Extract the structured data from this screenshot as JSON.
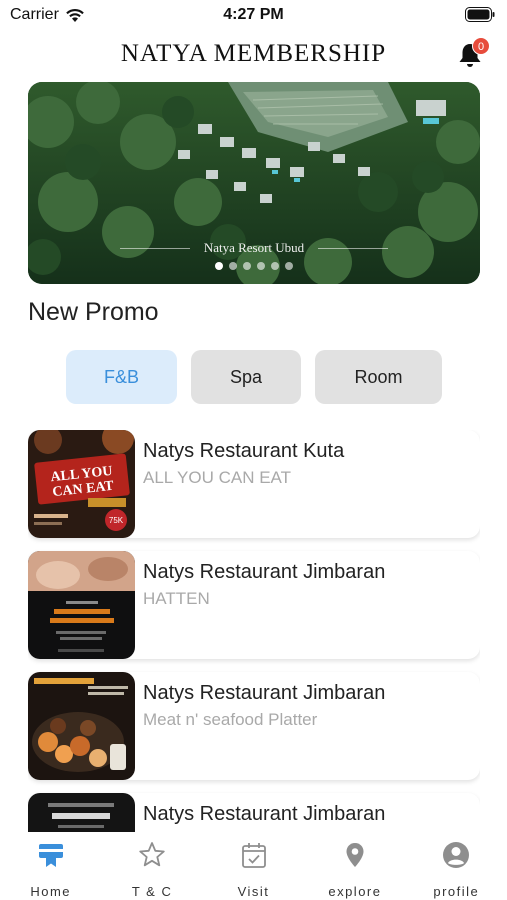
{
  "status": {
    "carrier": "Carrier",
    "time": "4:27 PM"
  },
  "header": {
    "title": "NATYA MEMBERSHIP",
    "notification_count": "0"
  },
  "banner": {
    "caption": "Natya Resort Ubud",
    "dot_count": 6,
    "active_dot": 0
  },
  "section": {
    "title": "New Promo"
  },
  "tabs": [
    {
      "label": "F&B",
      "active": true
    },
    {
      "label": "Spa",
      "active": false
    },
    {
      "label": "Room",
      "active": false
    }
  ],
  "promos": [
    {
      "name": "Natys Restaurant Kuta",
      "desc": "ALL YOU CAN EAT",
      "thumb_text": "ALL YOU CAN EAT"
    },
    {
      "name": "Natys Restaurant Jimbaran",
      "desc": "HATTEN",
      "thumb_text": "Wine By Glass Buy 1 Get 1 Free"
    },
    {
      "name": "Natys Restaurant Jimbaran",
      "desc": "Meat n' seafood Platter",
      "thumb_text": "Meat n' Seafood Platter"
    },
    {
      "name": "Natys Restaurant Jimbaran",
      "desc": "",
      "thumb_text": "IDR 150K"
    }
  ],
  "nav": [
    {
      "label": "Home",
      "icon": "home-card-icon",
      "active": true
    },
    {
      "label": "T & C",
      "icon": "star-icon",
      "active": false
    },
    {
      "label": "Visit",
      "icon": "calendar-check-icon",
      "active": false
    },
    {
      "label": "explore",
      "icon": "location-pin-icon",
      "active": false
    },
    {
      "label": "profile",
      "icon": "user-circle-icon",
      "active": false
    }
  ],
  "colors": {
    "accent": "#3a8fdb",
    "tab_active_bg": "#dcecfb",
    "tab_bg": "#e1e1e1",
    "badge": "#e74c3c",
    "muted_text": "#a9a9a9"
  }
}
